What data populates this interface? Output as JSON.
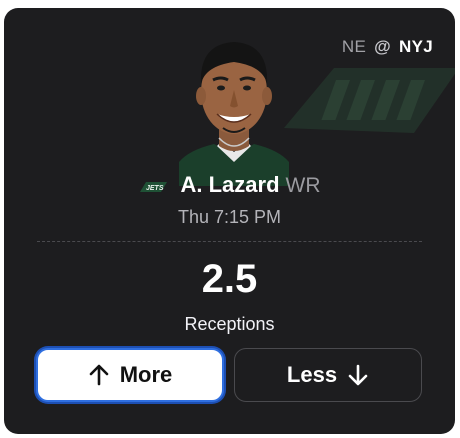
{
  "matchup": {
    "away_team": "NE",
    "separator": "@",
    "home_team": "NYJ"
  },
  "player": {
    "name": "A. Lazard",
    "position": "WR",
    "team_logo_icon": "jets-logo-icon",
    "photo_icon": "player-headshot"
  },
  "game": {
    "time": "Thu 7:15 PM"
  },
  "projection": {
    "value": "2.5",
    "stat": "Receptions"
  },
  "actions": {
    "more_label": "More",
    "less_label": "Less",
    "more_icon": "arrow-up-icon",
    "less_icon": "arrow-down-icon"
  },
  "colors": {
    "card_bg": "#1d1d1f",
    "selected_border": "#2f6fe0",
    "jets_green": "#1f3b2a"
  }
}
